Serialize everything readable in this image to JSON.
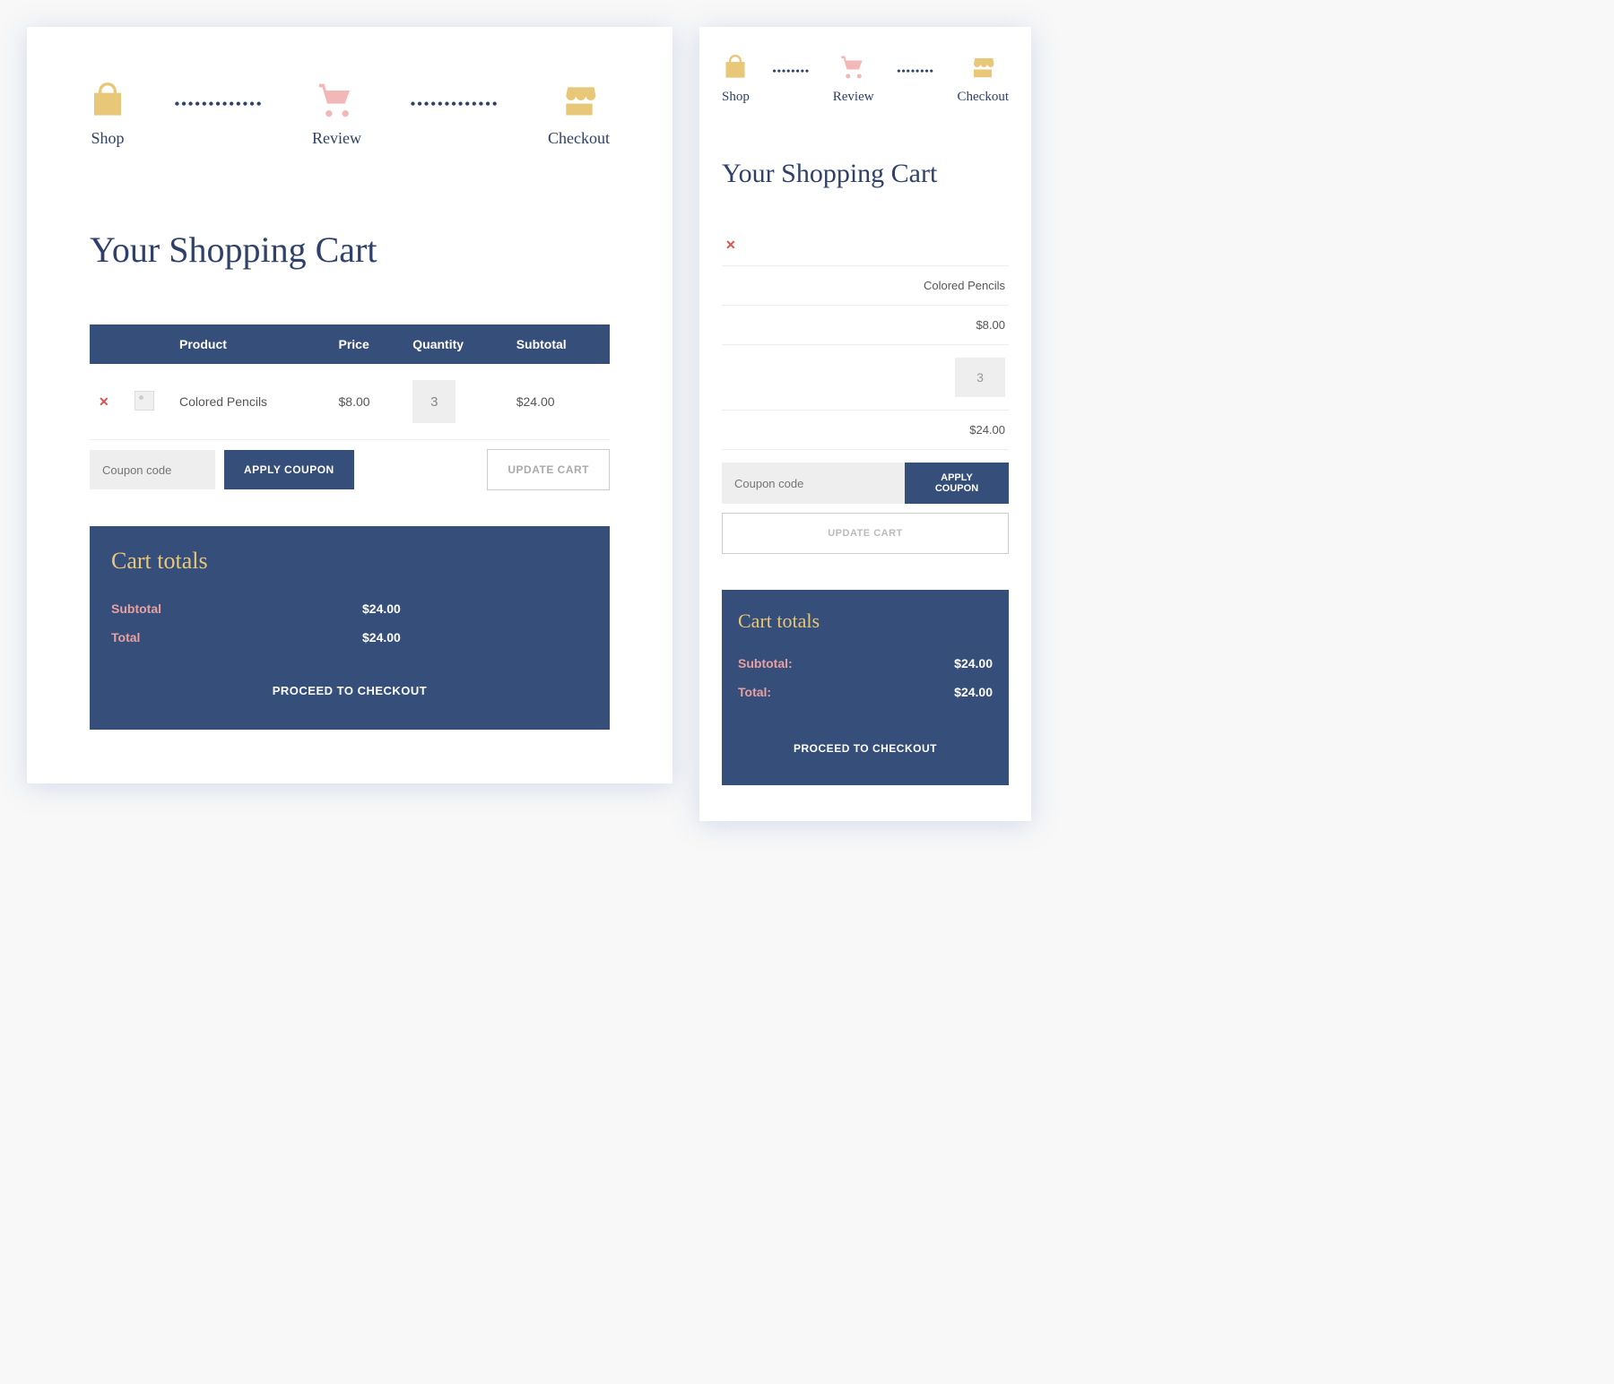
{
  "steps": {
    "shop": "Shop",
    "review": "Review",
    "checkout": "Checkout"
  },
  "title": "Your Shopping Cart",
  "table": {
    "headers": {
      "product": "Product",
      "price": "Price",
      "quantity": "Quantity",
      "subtotal": "Subtotal"
    },
    "item": {
      "name": "Colored Pencils",
      "price": "$8.00",
      "qty": "3",
      "subtotal": "$24.00"
    }
  },
  "coupon": {
    "placeholder": "Coupon code",
    "apply": "APPLY COUPON",
    "update": "UPDATE CART"
  },
  "totals": {
    "title": "Cart totals",
    "subtotal_label": "Subtotal",
    "subtotal_label_m": "Subtotal:",
    "subtotal_value": "$24.00",
    "total_label": "Total",
    "total_label_m": "Total:",
    "total_value": "$24.00",
    "checkout": "PROCEED TO CHECKOUT"
  },
  "mobile": {
    "price": "$8.00",
    "subtotal": "$24.00"
  }
}
